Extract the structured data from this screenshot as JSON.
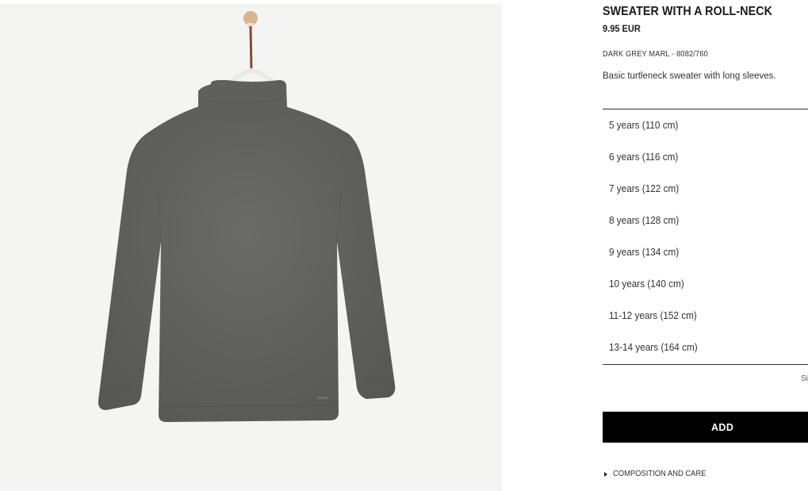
{
  "product": {
    "title": "SWEATER WITH A ROLL-NECK",
    "price": "9.95 EUR",
    "color_ref": "DARK GREY MARL - 8082/760",
    "description": "Basic turtleneck sweater with long sleeves.",
    "image_color": "#616161"
  },
  "sizes": [
    {
      "label": "5 years (110 cm)"
    },
    {
      "label": "6 years (116 cm)"
    },
    {
      "label": "7 years (122 cm)"
    },
    {
      "label": "8 years (128 cm)"
    },
    {
      "label": "9 years (134 cm)"
    },
    {
      "label": "10 years (140 cm)"
    },
    {
      "label": "11-12 years (152 cm)"
    },
    {
      "label": "13-14 years (164 cm)"
    }
  ],
  "size_guide_label": "Si",
  "add_button_label": "ADD",
  "composition_label": "COMPOSITION AND CARE"
}
